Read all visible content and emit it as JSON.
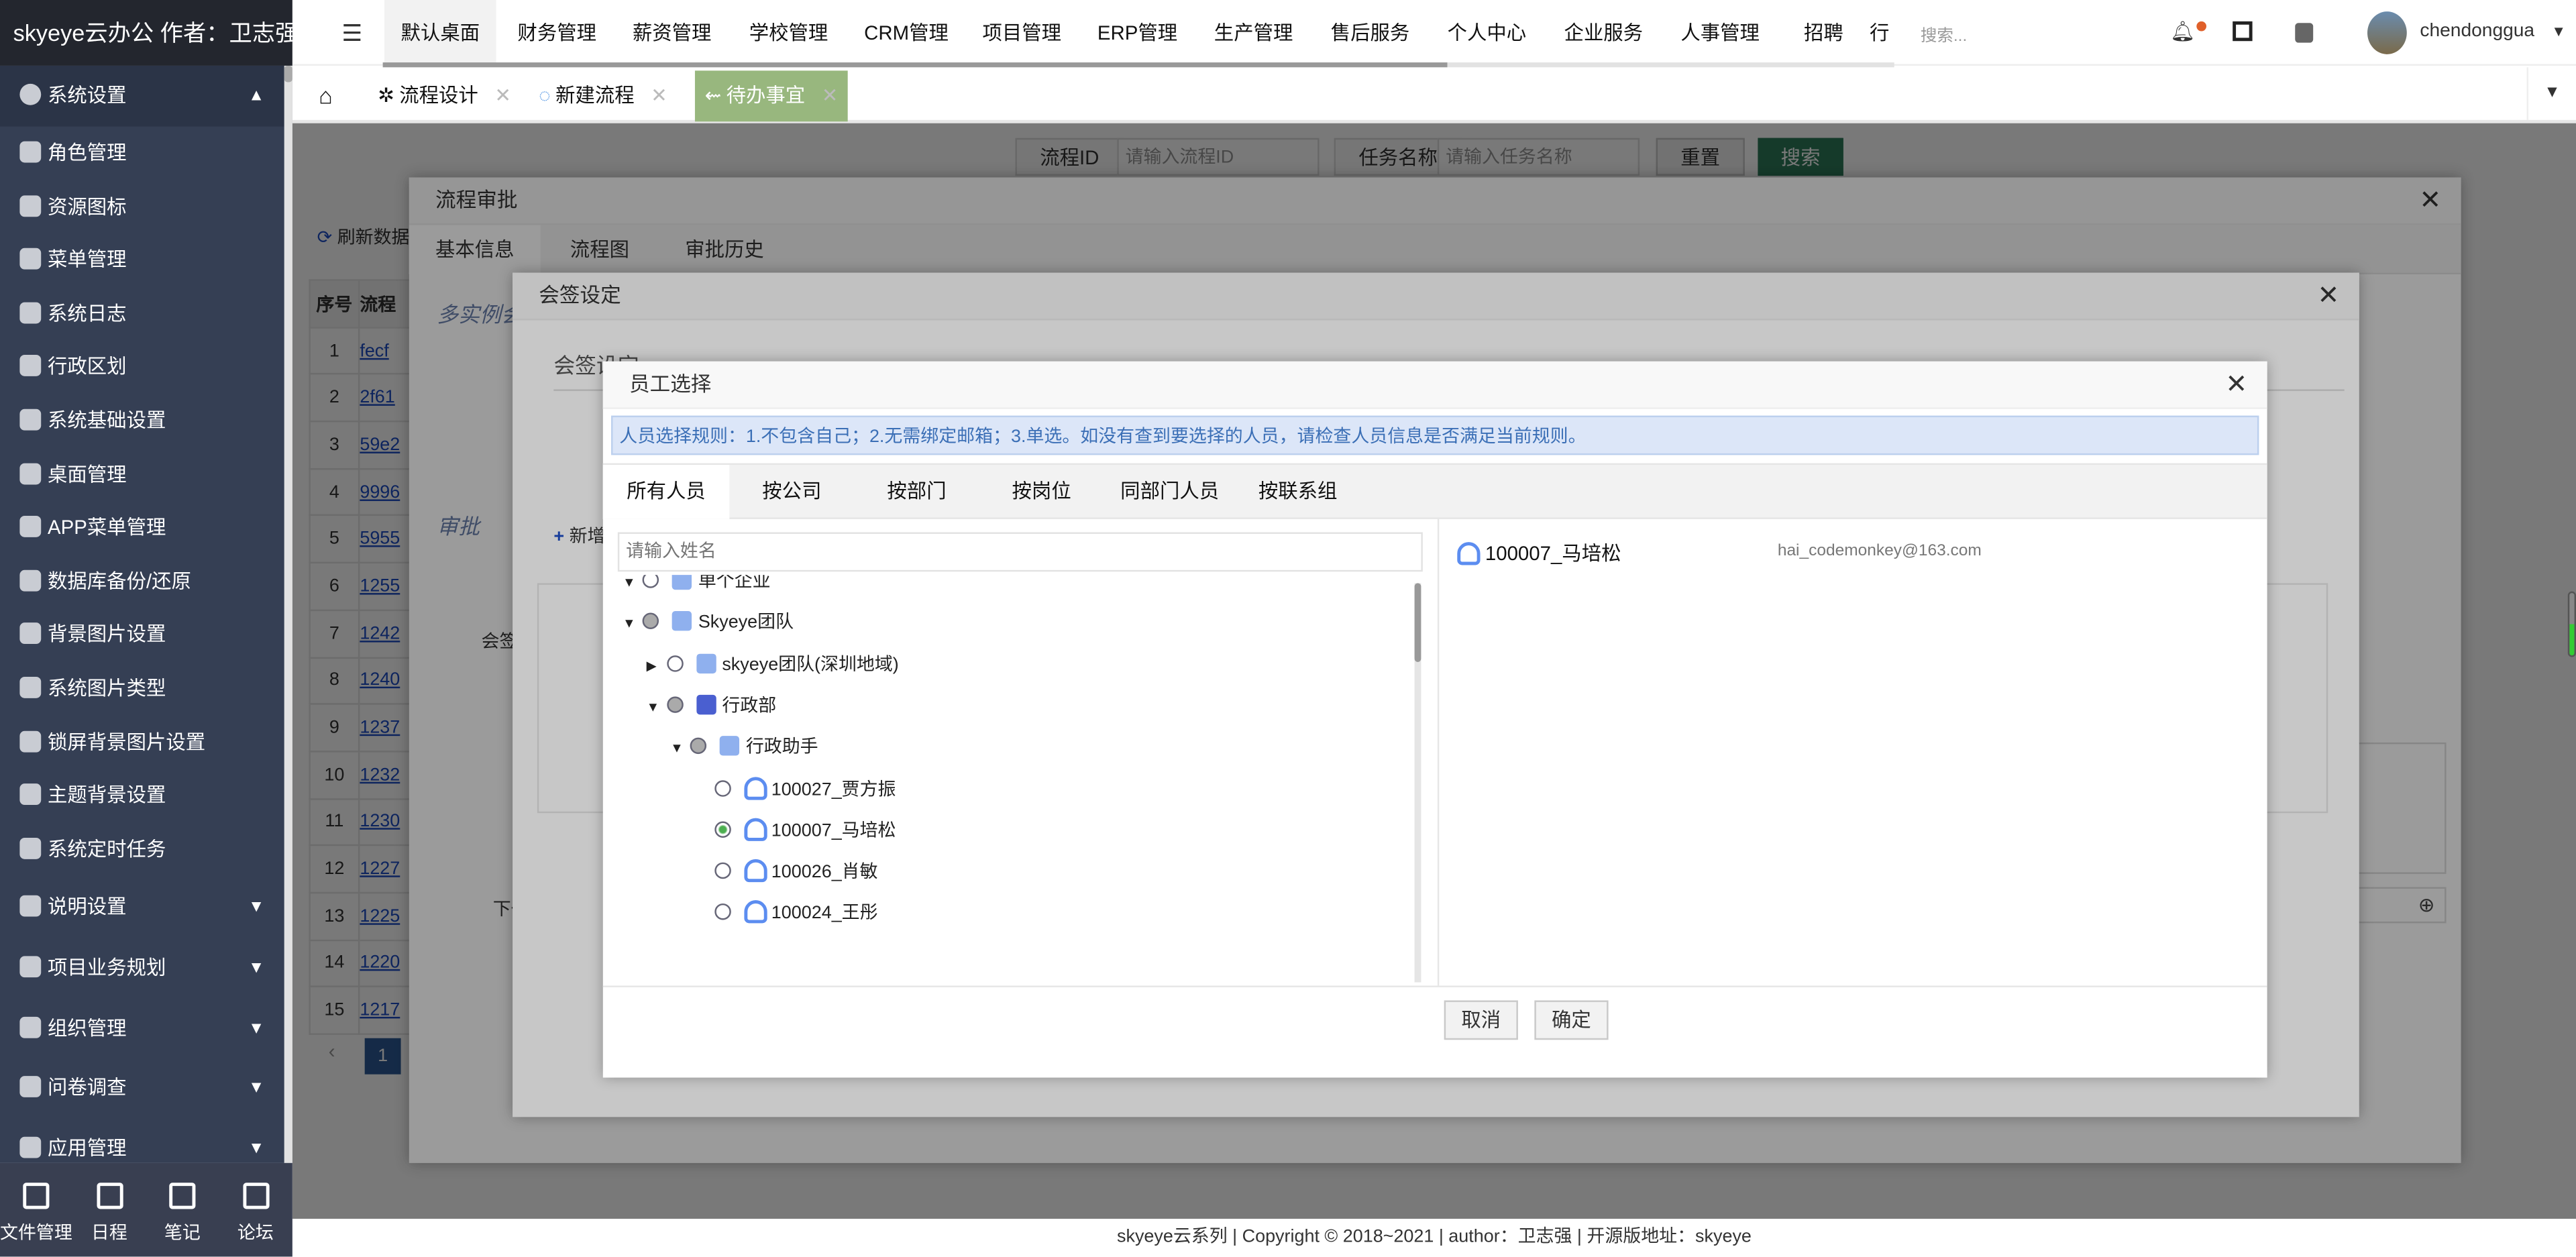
{
  "brand": "skyeye云办公 作者：卫志强",
  "sidebar": {
    "active_group": "系统设置",
    "items": [
      "角色管理",
      "资源图标",
      "菜单管理",
      "系统日志",
      "行政区划",
      "系统基础设置",
      "桌面管理",
      "APP菜单管理",
      "数据库备份/还原",
      "背景图片设置",
      "系统图片类型",
      "锁屏背景图片设置",
      "主题背景设置",
      "系统定时任务"
    ],
    "groups": [
      "说明设置",
      "项目业务规划",
      "组织管理",
      "问卷调查",
      "应用管理"
    ],
    "bottom": [
      {
        "label": "文件管理",
        "icon": "list-icon"
      },
      {
        "label": "日程",
        "icon": "calendar-icon"
      },
      {
        "label": "笔记",
        "icon": "edit-icon"
      },
      {
        "label": "论坛",
        "icon": "calendar-icon"
      }
    ]
  },
  "topnav": {
    "menus": [
      "默认桌面",
      "财务管理",
      "薪资管理",
      "学校管理",
      "CRM管理",
      "项目管理",
      "ERP管理",
      "生产管理",
      "售后服务",
      "个人中心",
      "企业服务",
      "人事管理",
      "招聘",
      "行"
    ],
    "search_placeholder": "搜索...",
    "username": "chendonggua"
  },
  "tabs": [
    {
      "label": "流程设计",
      "icon": "flow-icon"
    },
    {
      "label": "新建流程",
      "icon": "spinner-icon"
    },
    {
      "label": "待办事宜",
      "icon": "todo-icon",
      "active": true
    }
  ],
  "background": {
    "search": {
      "process_id_label": "流程ID",
      "process_id_placeholder": "请输入流程ID",
      "task_name_label": "任务名称",
      "task_name_placeholder": "请输入任务名称",
      "reset": "重置",
      "search": "搜索"
    },
    "refresh": "刷新数据",
    "table_headers": [
      "序号",
      "流程"
    ],
    "rows": [
      [
        "1",
        "fecf"
      ],
      [
        "2",
        "2f61"
      ],
      [
        "3",
        "59e2"
      ],
      [
        "4",
        "9996"
      ],
      [
        "5",
        "5955"
      ],
      [
        "6",
        "1255"
      ],
      [
        "7",
        "1242"
      ],
      [
        "8",
        "1240"
      ],
      [
        "9",
        "1237"
      ],
      [
        "10",
        "1232"
      ],
      [
        "11",
        "1230"
      ],
      [
        "12",
        "1227"
      ],
      [
        "13",
        "1225"
      ],
      [
        "14",
        "1220"
      ],
      [
        "15",
        "1217"
      ]
    ],
    "page": "1"
  },
  "approval_dialog": {
    "title": "流程审批",
    "tabs": [
      "基本信息",
      "流程图",
      "审批历史"
    ],
    "section1": "多实例会",
    "section2": "审批",
    "label_countersign": "会签",
    "label_next": "下一"
  },
  "countersign_dialog": {
    "title": "会签设定",
    "section": "会签设定",
    "add": "新增"
  },
  "staff_dialog": {
    "title": "员工选择",
    "rule": "人员选择规则：1.不包含自己；2.无需绑定邮箱；3.单选。如没有查到要选择的人员，请检查人员信息是否满足当前规则。",
    "tabs": [
      "所有人员",
      "按公司",
      "按部门",
      "按岗位",
      "同部门人员",
      "按联系组"
    ],
    "search_placeholder": "请输入姓名",
    "tree": [
      {
        "label": "单个企业",
        "expand": "open",
        "radio": "empty",
        "icon": "building-icon",
        "level": 0
      },
      {
        "label": "Skyeye团队",
        "expand": "open",
        "radio": "half",
        "icon": "building-icon",
        "level": 0
      },
      {
        "label": "skyeye团队(深圳地域)",
        "expand": "closed",
        "radio": "empty",
        "icon": "building-icon",
        "level": 1
      },
      {
        "label": "行政部",
        "expand": "open",
        "radio": "half",
        "icon": "layers-icon",
        "level": 1
      },
      {
        "label": "行政助手",
        "expand": "open",
        "radio": "half",
        "icon": "position-icon",
        "level": 2
      },
      {
        "label": "100027_贾方振",
        "radio": "empty",
        "icon": "user-icon",
        "level": 3
      },
      {
        "label": "100007_马培松",
        "radio": "selected",
        "icon": "user-icon",
        "level": 3
      },
      {
        "label": "100026_肖敏",
        "radio": "empty",
        "icon": "user-icon",
        "level": 3
      },
      {
        "label": "100024_王彤",
        "radio": "empty",
        "icon": "user-icon",
        "level": 3
      }
    ],
    "selected": {
      "name": "100007_马培松",
      "email": "hai_codemonkey@163.com"
    },
    "cancel": "取消",
    "confirm": "确定"
  },
  "footer": {
    "text": "skyeye云系列 | Copyright © 2018~2021 | author：卫志强 | 开源版地址：",
    "link": "skyeye"
  },
  "colors": {
    "accent_green": "#98b77e",
    "search_button": "#2f7d5b",
    "sidebar": "#353f54",
    "rule_bg": "#dce6f8"
  }
}
